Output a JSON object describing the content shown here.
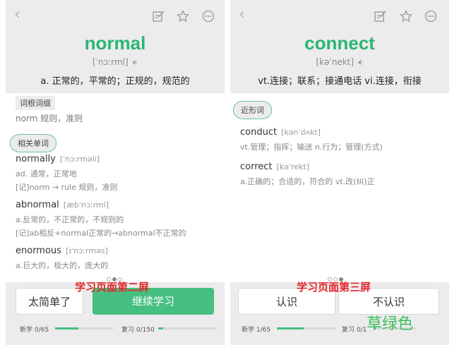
{
  "screen1": {
    "headword": "normal",
    "phonetic": "[ˈnɔːrml]",
    "meaning": "a. 正常的，平常的；正规的，规范的",
    "root_section": {
      "tag": "词根词缀",
      "line": "norm   规则，准则"
    },
    "related_section": {
      "tag": "相关单词",
      "words": [
        {
          "word": "normally",
          "phonetic": "[ˈnɔːrməli]",
          "lines": [
            "ad. 通常，正常地",
            "[记]norm → rule 规则，准则"
          ]
        },
        {
          "word": "abnormal",
          "phonetic": "[æbˈnɔːrml]",
          "lines": [
            "a.反常的，不正常的，不规则的",
            "[记]ab相反+normal正常的→abnormal不正常的"
          ]
        },
        {
          "word": "enormous",
          "phonetic": "[ɪˈnɔːrməs]",
          "lines": [
            "a.巨大的，极大的，庞大的"
          ]
        }
      ]
    },
    "caption": "学习页面第二屏",
    "buttons": {
      "too_easy": "太简单了",
      "continue": "继续学习"
    },
    "progress": {
      "new_label": "新学",
      "new_count": "0/65",
      "new_fraction": 0.4,
      "review_label": "复习",
      "review_count": "0/150",
      "review_fraction": 0.08
    },
    "pager": {
      "total": 3,
      "active": 1
    }
  },
  "screen2": {
    "headword": "connect",
    "phonetic": "[kəˈnekt]",
    "meaning": "vt.连接；联系；接通电话 vi.连接，衔接",
    "similar_section": {
      "tag": "近形词",
      "words": [
        {
          "word": "conduct",
          "phonetic": "[kənˈdʌkt]",
          "lines": [
            "vt.管理；指挥；输送 n.行为；管理(方式)"
          ]
        },
        {
          "word": "correct",
          "phonetic": "[kəˈrekt]",
          "lines": [
            "a.正确的；合适的，符合的 vt.改(纠)正"
          ]
        }
      ]
    },
    "caption": "学习页面第三屏",
    "buttons": {
      "know": "认识",
      "dont_know": "不认识"
    },
    "progress": {
      "new_label": "新学",
      "new_count": "1/65",
      "new_fraction": 0.45,
      "review_label": "复习",
      "review_count": "0/1",
      "review_fraction": 0.05
    },
    "pager": {
      "total": 3,
      "active": 2
    }
  },
  "watermark": "草绿色",
  "colors": {
    "accent_green": "#2bb673",
    "button_green": "#45bf82",
    "caption_red": "#e4262a",
    "header_gray": "#ececec"
  },
  "icons": [
    "back-icon",
    "note-icon",
    "star-icon",
    "more-icon",
    "speaker-icon"
  ]
}
